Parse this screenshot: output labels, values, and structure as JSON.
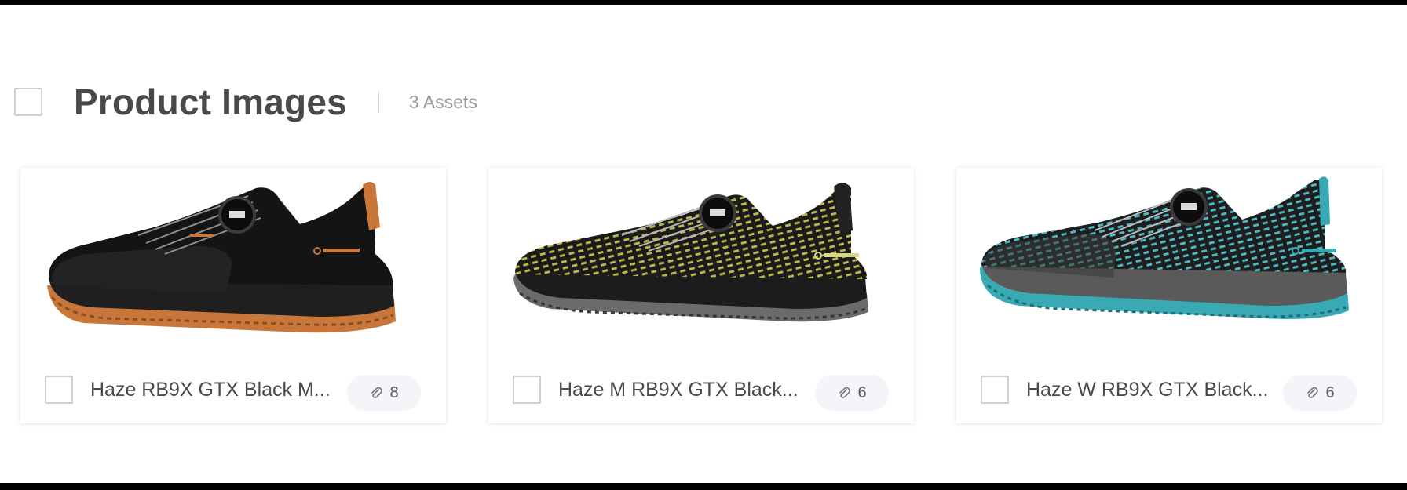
{
  "section": {
    "title": "Product Images",
    "asset_count": "3 Assets"
  },
  "assets": [
    {
      "name": "Haze RB9X GTX Black M...",
      "attachments": "8",
      "thumbnail": "black-shoe-orange-sole-icon",
      "accent": "#c9763a",
      "upper_pattern": "#2a2a2a"
    },
    {
      "name": "Haze M RB9X GTX Black...",
      "attachments": "6",
      "thumbnail": "black-shoe-yellow-pattern-icon",
      "accent": "#6b6b6b",
      "upper_pattern": "#b8b54a"
    },
    {
      "name": "Haze W RB9X GTX Black...",
      "attachments": "6",
      "thumbnail": "black-shoe-teal-pattern-icon",
      "accent": "#39a9b4",
      "upper_pattern": "#4bb7c2"
    }
  ]
}
